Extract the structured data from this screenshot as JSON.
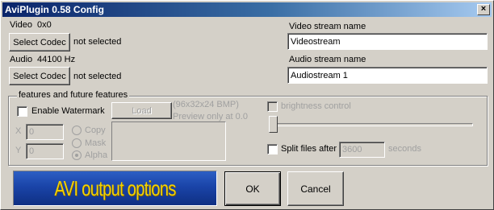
{
  "window": {
    "title": "AviPlugin 0.58 Config",
    "close_glyph": "×"
  },
  "video": {
    "label": "Video",
    "dims": "0x0",
    "codec_button": "Select Codec",
    "codec_status": "not selected"
  },
  "audio": {
    "label": "Audio",
    "rate": "44100 Hz",
    "codec_button": "Select Codec",
    "codec_status": "not selected"
  },
  "streams": {
    "video_name_label": "Video stream name",
    "video_name_value": "Videostream",
    "audio_name_label": "Audio stream name",
    "audio_name_value": "Audiostream 1"
  },
  "features": {
    "group_label": "features and future features",
    "watermark_label": "Enable Watermark",
    "load_button": "Load",
    "bmp_info": "(96x32x24 BMP)",
    "preview_info": "Preview only at 0.0",
    "x_label": "X",
    "x_value": "0",
    "y_label": "Y",
    "y_value": "0",
    "radio_copy": "Copy",
    "radio_mask": "Mask",
    "radio_alpha": "Alpha",
    "brightness_label": "brightness control",
    "split_label": "Split files after",
    "split_value": "3600",
    "split_unit": "seconds"
  },
  "banner": {
    "text": "AVI output options",
    "text_color": "#f2d200",
    "background_color": "#1a44a8"
  },
  "buttons": {
    "ok": "OK",
    "cancel": "Cancel"
  }
}
